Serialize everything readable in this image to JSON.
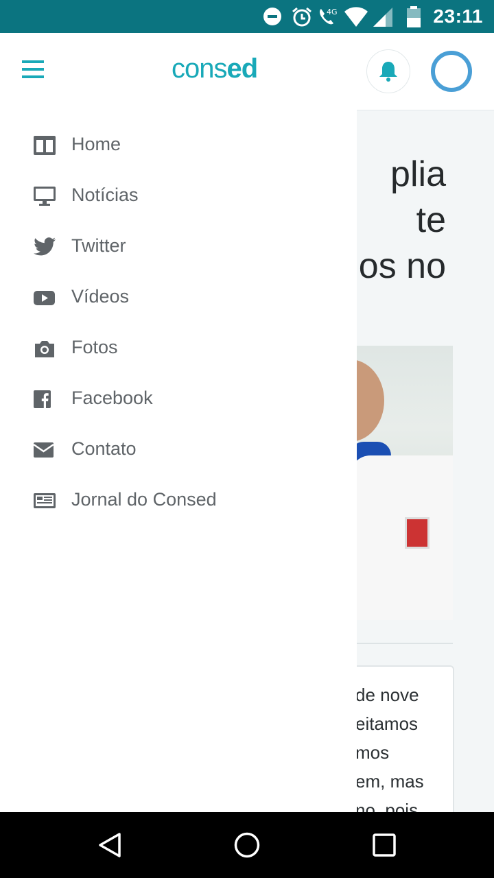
{
  "status_bar": {
    "time": "23:11",
    "network": "4G"
  },
  "app_bar": {
    "logo_prefix": "cons",
    "logo_suffix": "ed"
  },
  "article": {
    "title_lines": "plia\nte\nos no",
    "card_text_lines": "de nove\neitamos\nmos\nem, mas\nno, pois"
  },
  "drawer": {
    "items": [
      {
        "label": "Home",
        "icon": "home-icon"
      },
      {
        "label": "Notícias",
        "icon": "monitor-icon"
      },
      {
        "label": "Twitter",
        "icon": "twitter-icon"
      },
      {
        "label": "Vídeos",
        "icon": "youtube-icon"
      },
      {
        "label": "Fotos",
        "icon": "camera-icon"
      },
      {
        "label": "Facebook",
        "icon": "facebook-icon"
      },
      {
        "label": "Contato",
        "icon": "envelope-icon"
      },
      {
        "label": "Jornal do Consed",
        "icon": "newspaper-icon"
      }
    ]
  },
  "colors": {
    "status_bar": "#0b7480",
    "brand": "#19a9b8",
    "avatar_ring": "#4a9fd6",
    "menu_icon": "#5f6468"
  },
  "system_nav": {
    "icons": [
      "back-icon",
      "home-circle-icon",
      "recents-icon"
    ]
  }
}
